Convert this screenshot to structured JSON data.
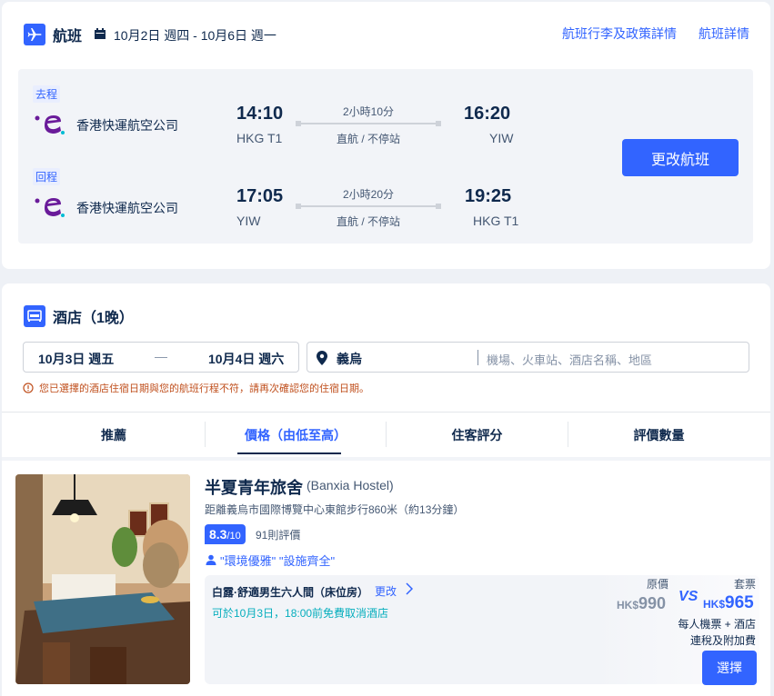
{
  "flight": {
    "title": "航班",
    "dates": "10月2日 週四 - 10月6日 週一",
    "links": [
      "航班行李及政策詳情",
      "航班詳情"
    ],
    "change_button": "更改航班",
    "outbound": {
      "tag": "去程",
      "airline": "香港快運航空公司",
      "dep_time": "14:10",
      "dep_code": "HKG T1",
      "duration": "2小時10分",
      "stops": "直航 / 不停站",
      "arr_time": "16:20",
      "arr_code": "YIW"
    },
    "return": {
      "tag": "回程",
      "airline": "香港快運航空公司",
      "dep_time": "17:05",
      "dep_code": "YIW",
      "duration": "2小時20分",
      "stops": "直航 / 不停站",
      "arr_time": "19:25",
      "arr_code": "HKG T1"
    }
  },
  "hotel": {
    "title": "酒店（1晚）",
    "checkin": "10月3日 週五",
    "dash": "—",
    "checkout": "10月4日 週六",
    "city": "義烏",
    "search_placeholder": "機場、火車站、酒店名稱、地區",
    "warning": "您已選擇的酒店住宿日期與您的航班行程不符，請再次確認您的住宿日期。",
    "tabs": [
      "推薦",
      "價格（由低至高）",
      "住客評分",
      "評價數量"
    ],
    "listing": {
      "name": "半夏青年旅舍",
      "name_en": "(Banxia Hostel)",
      "distance": "距離義烏市國際博覽中心東館步行860米（約13分鐘）",
      "score": "8.3",
      "score_max": "/10",
      "reviews": "91則評價",
      "highlights": "\"環境優雅\" \"設施齊全\"",
      "room": "白露·舒適男生六人間（床位房）",
      "change": "更改",
      "cancel": "可於10月3日，18:00前免費取消酒店",
      "orig_label": "原價",
      "orig_currency": "HK$",
      "orig_price": "990",
      "vs": "VS",
      "pkg_label": "套票",
      "pkg_currency": "HK$",
      "pkg_price": "965",
      "note1": "每人機票 + 酒店",
      "note2": "連稅及附加費",
      "select": "選擇"
    }
  }
}
